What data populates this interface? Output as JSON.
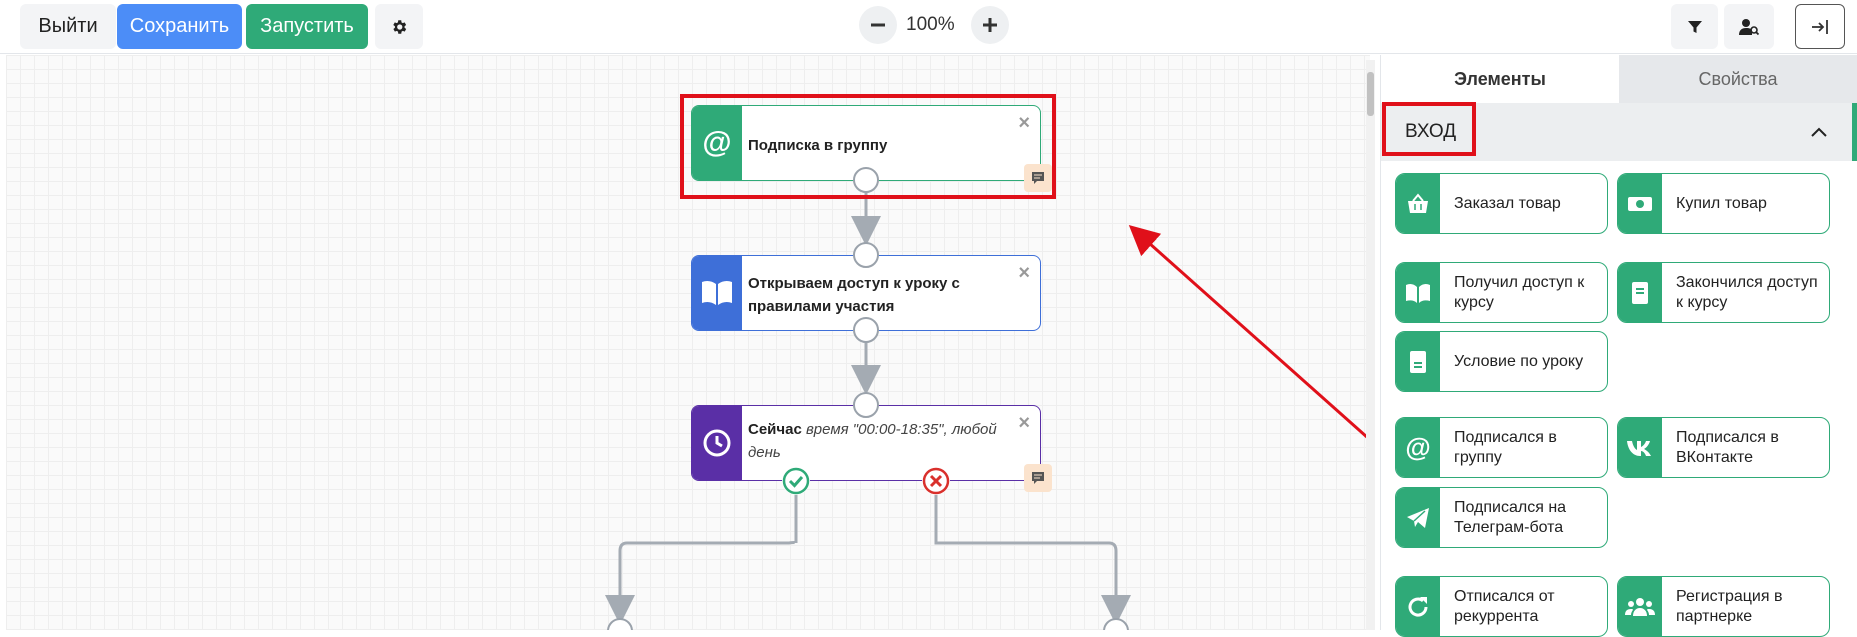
{
  "toolbar": {
    "exit_label": "Выйти",
    "save_label": "Сохранить",
    "run_label": "Запустить",
    "zoom_level": "100%",
    "icons": [
      "gear-icon",
      "minus-icon",
      "plus-icon",
      "filter-icon",
      "user-search-icon",
      "sidebar-collapse-icon"
    ]
  },
  "canvas": {
    "nodes": [
      {
        "title": "Подписка в группу",
        "rest": "",
        "icon": "at-icon",
        "color": "#2faa78",
        "has_note": true
      },
      {
        "title": "Открываем доступ к уроку с правилами участия",
        "rest": "",
        "icon": "book-icon",
        "color": "#3e6fd8",
        "has_note": false
      },
      {
        "title": "Сейчас",
        "rest": "время \"00:00-18:35\", любой день",
        "icon": "clock-icon",
        "color": "#5a2fa6",
        "has_note": true
      }
    ]
  },
  "panel": {
    "tabs": [
      "Элементы",
      "Свойства"
    ],
    "active_tab": "Элементы",
    "section_title": "ВХОД",
    "accent_color": "#2faa78",
    "tiles": [
      {
        "label": "Заказал товар",
        "icon": "basket-icon"
      },
      {
        "label": "Купил товар",
        "icon": "money-icon"
      },
      {
        "label": "Получил доступ к курсу",
        "icon": "book-icon"
      },
      {
        "label": "Закончился доступ к курсу",
        "icon": "document-icon"
      },
      {
        "label": "Условие по уроку",
        "icon": "lesson-icon"
      },
      {
        "label": "Подписался в группу",
        "icon": "at-icon"
      },
      {
        "label": "Подписался в ВКонтакте",
        "icon": "vk-icon"
      },
      {
        "label": "Подписался на Телеграм-бота",
        "icon": "telegram-icon"
      },
      {
        "label": "Отписался от рекуррента",
        "icon": "refresh-icon"
      },
      {
        "label": "Регистрация в партнерке",
        "icon": "users-icon"
      }
    ]
  }
}
